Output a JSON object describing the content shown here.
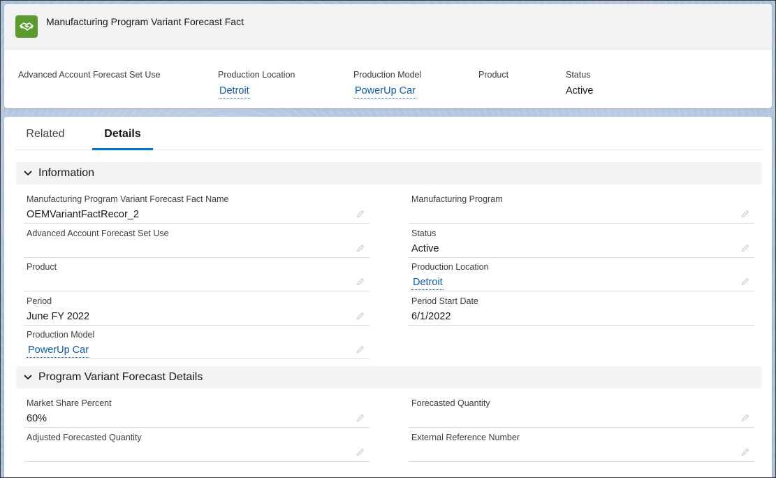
{
  "header": {
    "title": "Manufacturing Program Variant Forecast Fact",
    "icon": "handshake-icon",
    "icon_color": "#5b9a2f",
    "fields": [
      {
        "label": "Advanced Account Forecast Set Use",
        "value": ""
      },
      {
        "label": "Production Location",
        "value": "Detroit"
      },
      {
        "label": "Production Model",
        "value": "PowerUp Car"
      },
      {
        "label": "Product",
        "value": ""
      },
      {
        "label": "Status",
        "value": "Active"
      }
    ]
  },
  "tabs": [
    {
      "label": "Related",
      "active": false
    },
    {
      "label": "Details",
      "active": true
    }
  ],
  "sections": [
    {
      "title": "Information",
      "fields": [
        {
          "label": "Manufacturing Program Variant Forecast Fact Name",
          "value": "OEMVariantFactRecor_2"
        },
        {
          "label": "Manufacturing Program",
          "value": ""
        },
        {
          "label": "Advanced Account Forecast Set Use",
          "value": ""
        },
        {
          "label": "Status",
          "value": "Active"
        },
        {
          "label": "Product",
          "value": ""
        },
        {
          "label": "Production Location",
          "value": "Detroit"
        },
        {
          "label": "Period",
          "value": "June FY 2022"
        },
        {
          "label": "Period Start Date",
          "value": "6/1/2022"
        },
        {
          "label": "Production Model",
          "value": "PowerUp Car"
        }
      ]
    },
    {
      "title": "Program Variant Forecast Details",
      "fields": [
        {
          "label": "Market Share Percent",
          "value": "60%"
        },
        {
          "label": "Forecasted Quantity",
          "value": ""
        },
        {
          "label": "Adjusted Forecasted Quantity",
          "value": ""
        },
        {
          "label": "External Reference Number",
          "value": ""
        }
      ]
    }
  ],
  "colors": {
    "link": "#0b5cab",
    "tab_active_underline": "#0176d3",
    "section_bg": "#f3f3f3"
  }
}
